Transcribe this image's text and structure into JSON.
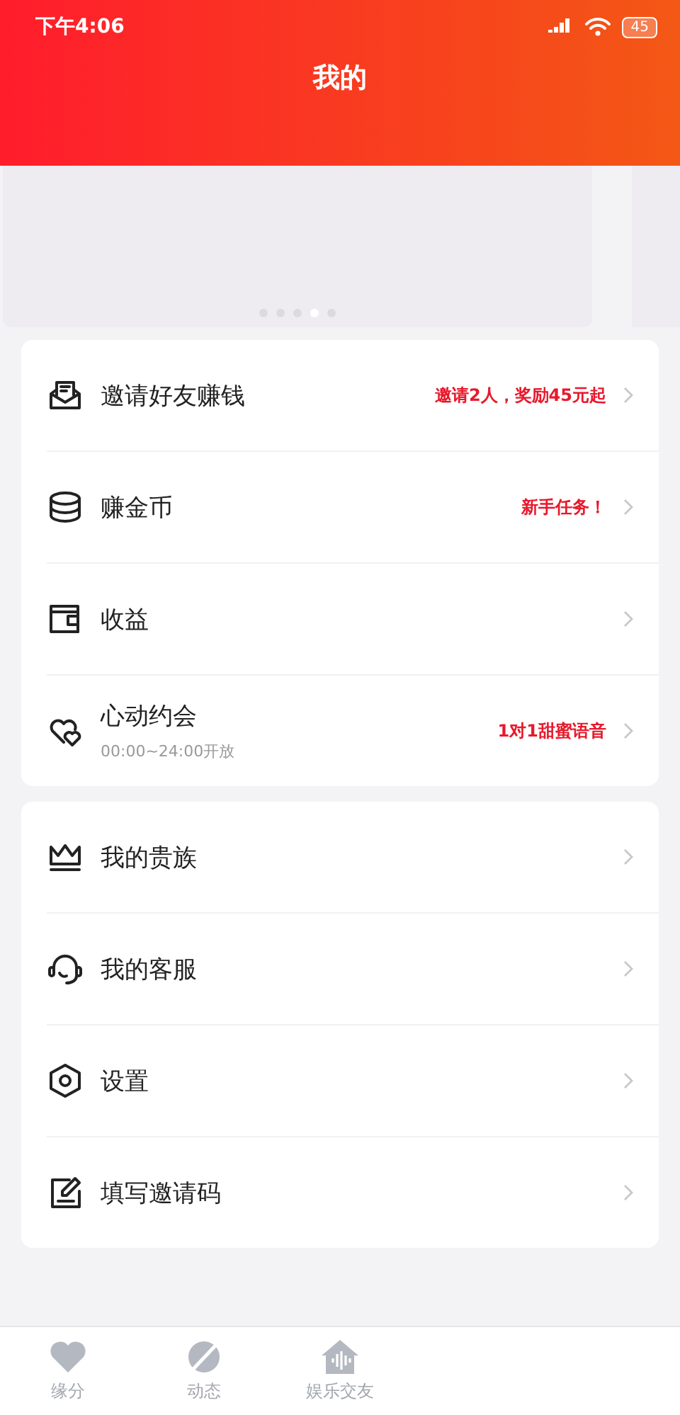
{
  "status_bar": {
    "time": "下午4:06",
    "battery": "45"
  },
  "header": {
    "title": "我的"
  },
  "carousel": {
    "dots": [
      {
        "selected": false
      },
      {
        "selected": false
      },
      {
        "selected": false
      },
      {
        "selected": true
      },
      {
        "selected": false
      }
    ]
  },
  "menu_groups": [
    {
      "items": [
        {
          "label": "邀请好友赚钱",
          "note": "邀请2人，奖励45元起"
        },
        {
          "label": "赚金币",
          "note": "新手任务！"
        },
        {
          "label": "收益"
        },
        {
          "label": "心动约会",
          "sublabel": "00:00~24:00开放",
          "note": "1对1甜蜜语音"
        }
      ]
    },
    {
      "items": [
        {
          "label": "我的贵族"
        },
        {
          "label": "我的客服"
        },
        {
          "label": "设置"
        },
        {
          "label": "填写邀请码"
        }
      ]
    }
  ],
  "tab_bar": {
    "tabs": [
      {
        "label": "缘分",
        "selected": false
      },
      {
        "label": "动态",
        "selected": false
      },
      {
        "label": "娱乐交友",
        "selected": false
      }
    ]
  }
}
